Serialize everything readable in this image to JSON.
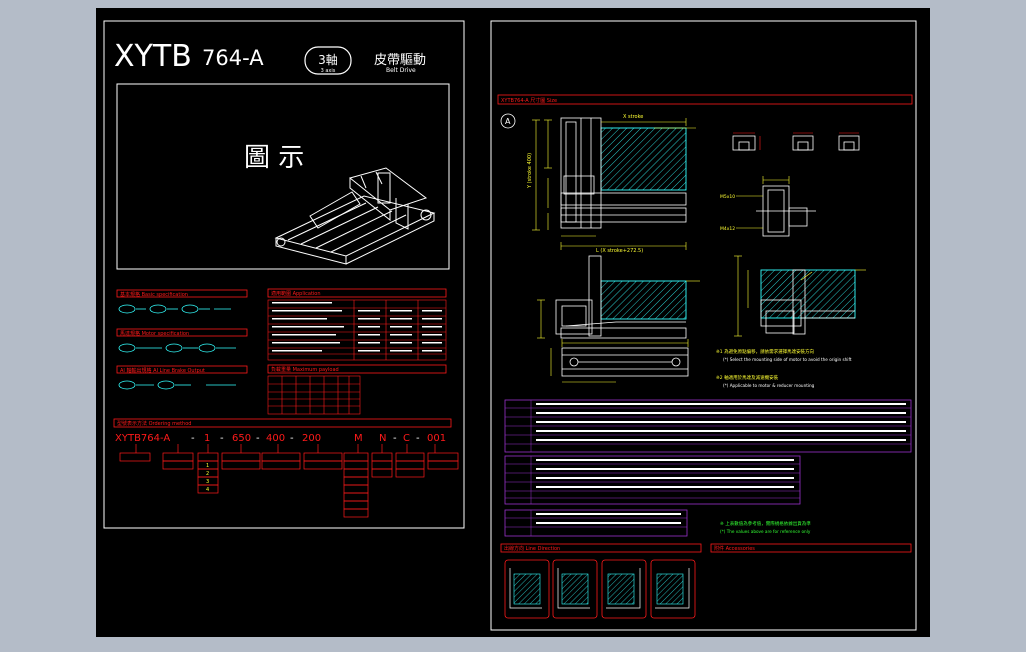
{
  "left_sheet": {
    "model": "XYTB",
    "model_number": "764-A",
    "axis_badge": "3軸",
    "axis_badge_sub": "3 axis",
    "drive_cn": "皮帶驅動",
    "drive_en": "Belt Drive",
    "figure_title": "圖 示",
    "sections": {
      "basic_spec": "基本規格 Basic specification",
      "motor_spec": "馬達規格 Motor specification",
      "ai_output": "AI 軸輸出規格 AI Line Brake Output",
      "applicable": "適用範圍 Application",
      "payload": "負載重量 Maximum payload",
      "ordering": "型號表示方法 Ordering method"
    },
    "ordering_code": [
      "XYTB764-A",
      "1",
      "650",
      "400",
      "200",
      "M",
      "N",
      "C",
      "001"
    ],
    "order_options": [
      "1",
      "2",
      "3",
      "4"
    ]
  },
  "right_sheet": {
    "dimension_title": "XYTB764-A 尺寸圖 Size",
    "view_label": "A",
    "dim_labels": {
      "x_stroke": "X stroke",
      "y_stroke": "Y (stroke 400)",
      "l_stroke": "L (X stroke+272.5)",
      "m_bolt": "M5x10",
      "m_bolt_2": "M4x12"
    },
    "note_1_cn": "※1 為避免原點偏移，請依需求選擇馬達安裝方向",
    "note_1_en": "(*) Select the mounting side of motor to avoid the origin shift",
    "note_2_cn": "※2 軸適用於馬達及減速機安裝",
    "note_2_en": "(*) Applicable to motor & reducer mounting",
    "footnote_cn": "※ 上表數值為參考值，實際規格依據出貨為準",
    "footnote_en": "(*) The values above are for reference only",
    "line_direction": "出線方向 Line Direction",
    "accessories": "附件 Accessories"
  },
  "colors": {
    "red": "#ff1a1a",
    "yellow": "#ffff33",
    "cyan": "#33ffff",
    "green": "#33ff33",
    "magenta": "#ff33ff",
    "purple": "#9a33cc",
    "white": "#ffffff"
  }
}
